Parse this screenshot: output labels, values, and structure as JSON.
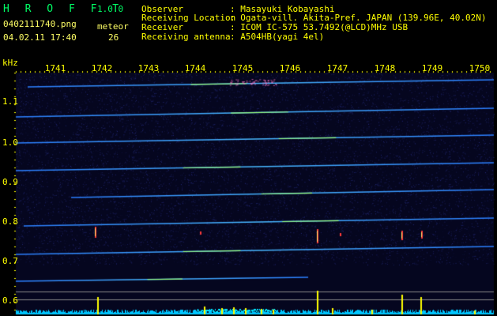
{
  "app": {
    "logo": "H R O F F T",
    "version": "1.0.0"
  },
  "file": {
    "name": "0402111740.png",
    "datetime": "04.02.11 17:40"
  },
  "meteor": {
    "label": "meteor",
    "count": "26"
  },
  "header_rows": [
    {
      "key": "Observer",
      "value": ": Masayuki Kobayashi"
    },
    {
      "key": "Receiving Location",
      "value": ": Ogata-vill. Akita-Pref. JAPAN (139.96E, 40.02N)"
    },
    {
      "key": "Receiver",
      "value": ": ICOM IC-575 53.7492(@LCD)MHz USB"
    },
    {
      "key": "Receiving antenna",
      "value": ": A504HB(yagi 4el)"
    }
  ],
  "axes": {
    "y_unit": "kHz",
    "x_ticks": [
      "1741",
      "1742",
      "1743",
      "1744",
      "1745",
      "1746",
      "1747",
      "1748",
      "1749",
      "1750"
    ],
    "y_ticks": [
      "1.1",
      "1.0",
      "0.9",
      "0.8",
      "0.7",
      "0.6"
    ]
  },
  "colors": {
    "bg": "#000000",
    "text": "#ffff00",
    "band": "#3fa0ff",
    "bar": "#ffff00",
    "cyan": "#00e5ff"
  }
}
